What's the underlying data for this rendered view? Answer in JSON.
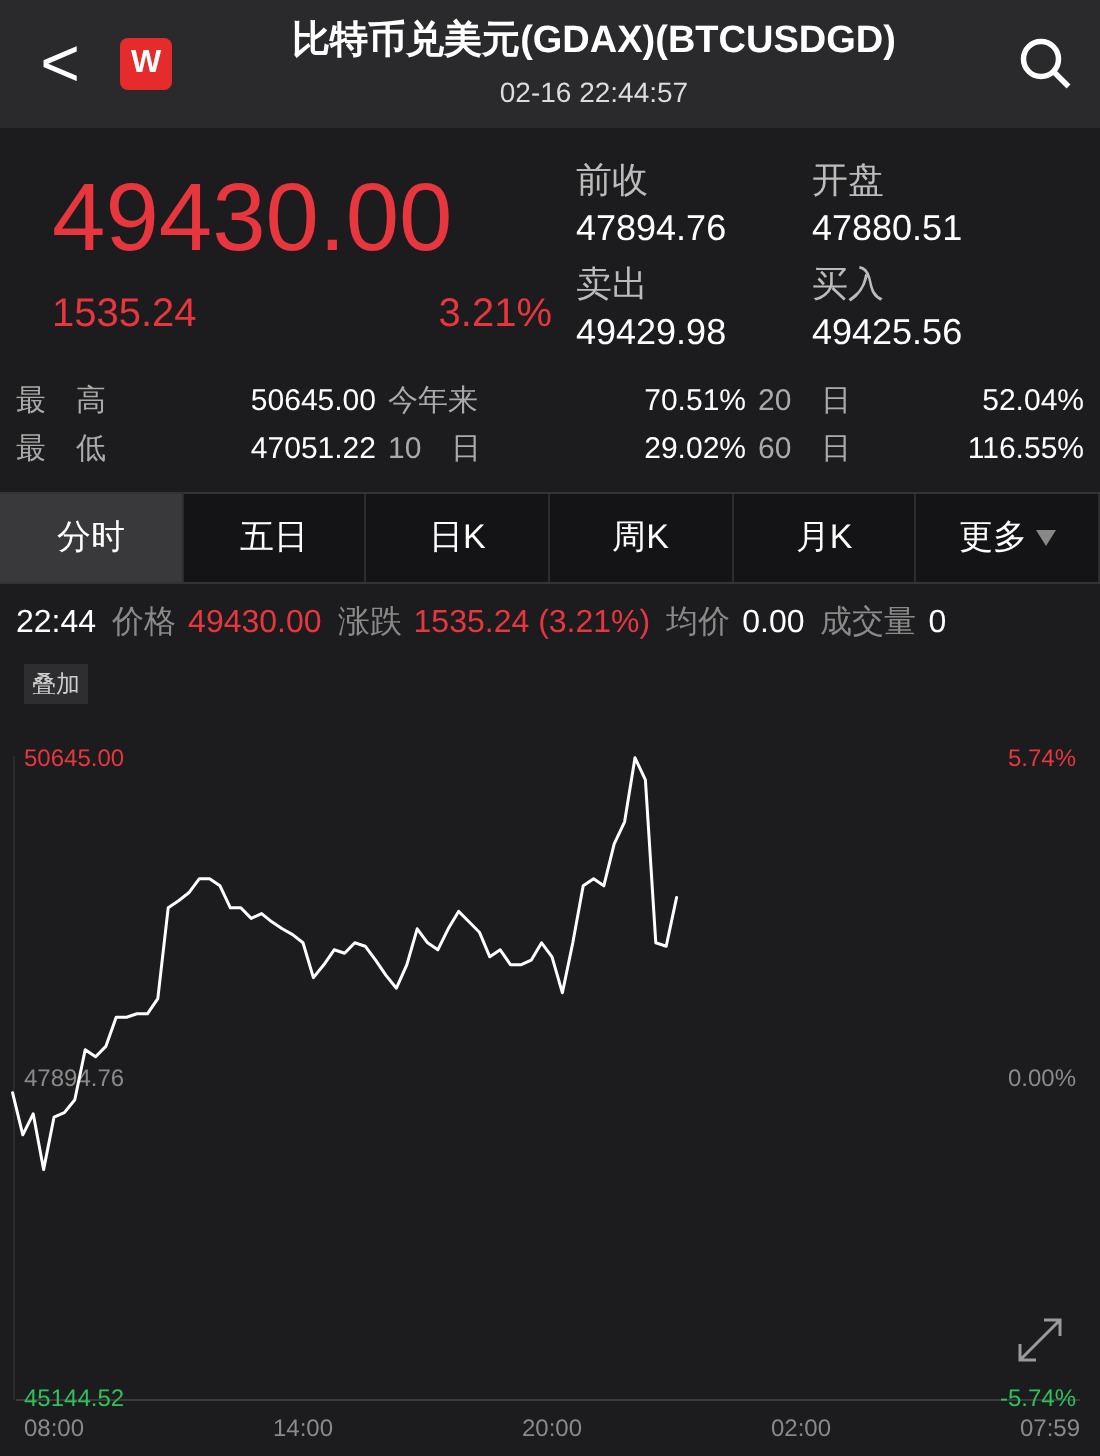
{
  "header": {
    "back": "<",
    "logo": "W",
    "title": "比特币兑美元(GDAX)(BTCUSDGD)",
    "time": "02-16 22:44:57"
  },
  "quote": {
    "price": "49430.00",
    "change": "1535.24",
    "percent": "3.21%"
  },
  "stats": [
    {
      "label": "前收",
      "value": "47894.76"
    },
    {
      "label": "开盘",
      "value": "47880.51"
    },
    {
      "label": "卖出",
      "value": "49429.98"
    },
    {
      "label": "买入",
      "value": "49425.56"
    }
  ],
  "ranges": [
    [
      {
        "label": "最　高",
        "value": "50645.00"
      },
      {
        "label": "今年来",
        "value": "70.51%"
      },
      {
        "label": "20　日",
        "value": "52.04%"
      }
    ],
    [
      {
        "label": "最　低",
        "value": "47051.22"
      },
      {
        "label": "10　日",
        "value": "29.02%"
      },
      {
        "label": "60　日",
        "value": "116.55%"
      }
    ]
  ],
  "tabs": [
    {
      "label": "分时",
      "selected": true
    },
    {
      "label": "五日",
      "selected": false
    },
    {
      "label": "日K",
      "selected": false
    },
    {
      "label": "周K",
      "selected": false
    },
    {
      "label": "月K",
      "selected": false
    },
    {
      "label": "更多",
      "selected": false,
      "kind": "dropdown"
    }
  ],
  "info": [
    {
      "label": "22:44",
      "kind": "time"
    },
    {
      "label": "价格",
      "value": "49430.00",
      "color": "#e8363f"
    },
    {
      "label": "涨跌",
      "value": "1535.24 (3.21%)",
      "color": "#e8363f"
    },
    {
      "label": "均价",
      "value": "0.00",
      "color": "#ffffff"
    },
    {
      "label": "成交量",
      "value": "0",
      "color": "#ffffff"
    }
  ],
  "overlay_button": "叠加",
  "right_labels": [
    {
      "label": "5.74%",
      "color": "#e8363f"
    },
    {
      "label": "0.00%",
      "color": "#8a8a8a"
    },
    {
      "label": "-5.74%",
      "color": "#2ec05a"
    }
  ],
  "chart_data": {
    "type": "line",
    "ylim": [
      45144.52,
      50645
    ],
    "categories": [
      null,
      null,
      null,
      null,
      "08:00",
      null,
      null,
      null,
      null,
      null,
      null,
      null,
      null,
      null,
      null,
      null,
      null,
      null,
      null,
      null,
      null,
      null,
      null,
      null,
      null,
      null,
      null,
      null,
      "14:00",
      null,
      null,
      null,
      null,
      null,
      null,
      null,
      null,
      null,
      null,
      null,
      null,
      null,
      null,
      null,
      null,
      null,
      null,
      null,
      null,
      null,
      null,
      null,
      "20:00",
      null,
      null,
      null,
      null,
      null,
      null,
      null,
      null,
      null,
      null,
      null,
      null,
      null,
      null,
      null,
      null,
      null,
      null,
      null,
      null,
      null,
      null,
      null,
      "02:00",
      null,
      null,
      null,
      null,
      null,
      null,
      null,
      null,
      null,
      null,
      null,
      null,
      null,
      null,
      null,
      null,
      null,
      null,
      null,
      null,
      null,
      null,
      null,
      "07:59"
    ],
    "yticks": [
      {
        "value": 50645,
        "label": "50645.00"
      },
      {
        "value": 47894.76,
        "label": "47894.76"
      },
      {
        "value": 45144.52,
        "label": "45144.52"
      }
    ],
    "series": [
      {
        "color": "#ffffff",
        "values": [
          47750,
          47390,
          47570,
          47090,
          47540,
          47580,
          47690,
          48120,
          48060,
          48150,
          48400,
          48400,
          48430,
          48430,
          48560,
          49340,
          49400,
          49470,
          49590,
          49590,
          49530,
          49340,
          49340,
          49250,
          49290,
          49220,
          49160,
          49110,
          49040,
          48740,
          48850,
          48980,
          48950,
          49040,
          49010,
          48890,
          48760,
          48650,
          48850,
          49160,
          49040,
          48980,
          49160,
          49310,
          49220,
          49130,
          48920,
          48980,
          48850,
          48850,
          48890,
          49040,
          48920,
          48610,
          49040,
          49530,
          49590,
          49530,
          49890,
          50080,
          50630,
          50440,
          49040,
          49010,
          49430,
          null,
          null,
          null,
          null,
          null,
          null,
          null,
          null,
          null,
          null,
          null,
          null,
          null,
          null,
          null,
          null,
          null,
          null,
          null,
          null,
          null,
          null,
          null,
          null,
          null,
          null,
          null,
          null,
          null,
          null,
          null,
          null,
          null,
          null,
          null,
          null
        ]
      }
    ]
  }
}
